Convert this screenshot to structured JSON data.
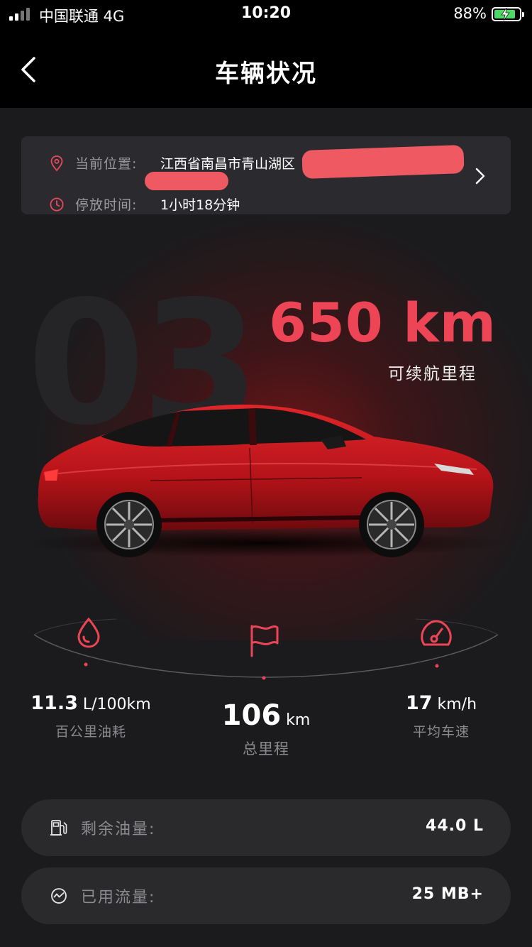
{
  "status_bar": {
    "carrier": "中国联通  4G",
    "time": "10:20",
    "battery_percent": "88%",
    "battery_color": "#4cd964"
  },
  "nav": {
    "title": "车辆状况",
    "back_icon": "chevron-left-icon"
  },
  "location_card": {
    "location_label": "当前位置:",
    "location_value": "江西省南昌市青山湖区",
    "parking_label": "停放时间:",
    "parking_value": "1小时18分钟",
    "location_icon": "location-pin-icon",
    "parking_icon": "clock-icon",
    "chevron_icon": "chevron-right-icon"
  },
  "hero": {
    "model_watermark": "03",
    "range_value": "650 km",
    "range_label": "可续航里程",
    "accent_color": "#ee4556"
  },
  "stats": {
    "fuel_consumption": {
      "value": "11.3",
      "unit": " L/100km",
      "label": "百公里油耗",
      "icon": "drop-icon"
    },
    "total_mileage": {
      "value": "106",
      "unit": " km",
      "label": "总里程",
      "icon": "flag-icon"
    },
    "avg_speed": {
      "value": "17",
      "unit": " km/h",
      "label": "平均车速",
      "icon": "speedometer-icon"
    }
  },
  "info_rows": {
    "fuel": {
      "label": "剩余油量:",
      "value": "44.0 L",
      "icon": "fuel-pump-icon"
    },
    "data": {
      "label": "已用流量:",
      "value": "25 MB+",
      "icon": "data-usage-icon"
    }
  }
}
